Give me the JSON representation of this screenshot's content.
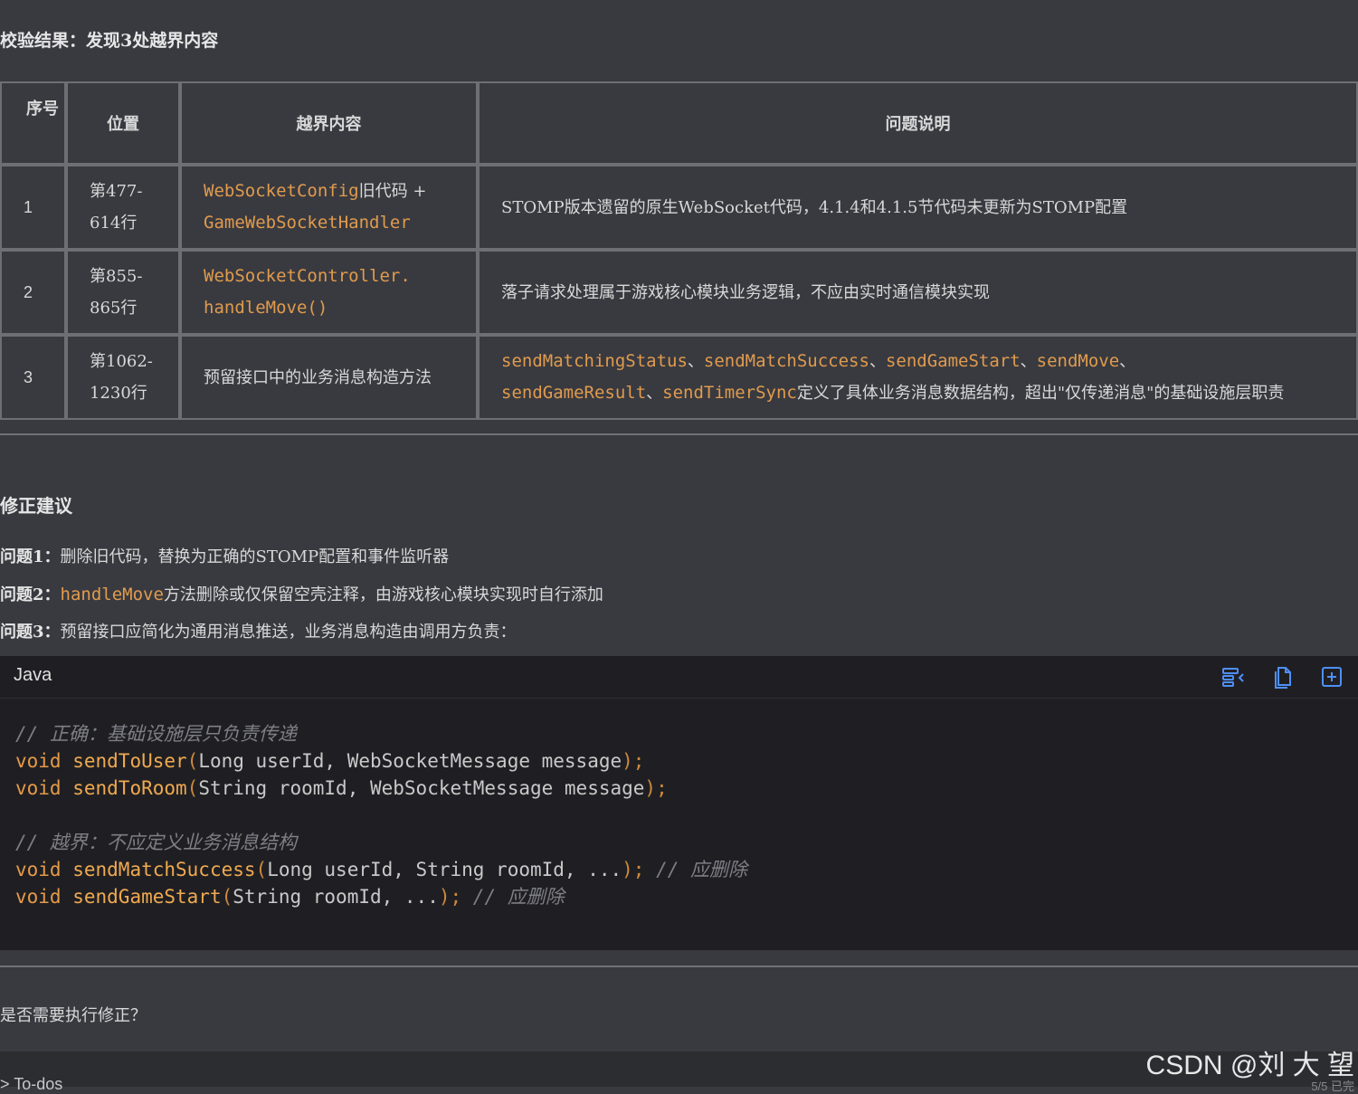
{
  "result_heading": "校验结果：发现3处越界内容",
  "table": {
    "headers": [
      "序号",
      "位置",
      "越界内容",
      "问题说明"
    ],
    "rows": [
      {
        "seq": "1",
        "location_a": "第477-",
        "location_b": "614行",
        "content_code_a": "WebSocketConfig",
        "content_text_a": "旧代码 +",
        "content_code_b": "GameWebSocketHandler",
        "description": "STOMP版本遗留的原生WebSocket代码，4.1.4和4.1.5节代码未更新为STOMP配置"
      },
      {
        "seq": "2",
        "location_a": "第855-",
        "location_b": "865行",
        "content_code_a": "WebSocketController.",
        "content_code_b": "handleMove()",
        "description": "落子请求处理属于游戏核心模块业务逻辑，不应由实时通信模块实现"
      },
      {
        "seq": "3",
        "location_a": "第1062-",
        "location_b": "1230行",
        "content_text": "预留接口中的业务消息构造方法",
        "desc_methods_1": [
          "sendMatchingStatus",
          "sendMatchSuccess",
          "sendGameStart",
          "sendMove"
        ],
        "desc_methods_2": [
          "sendGameResult",
          "sendTimerSync"
        ],
        "separator": "、",
        "description_tail": "定义了具体业务消息数据结构，超出\"仅传递消息\"的基础设施层职责"
      }
    ]
  },
  "fix": {
    "heading": "修正建议",
    "items": [
      {
        "label": "问题1：",
        "text": "删除旧代码，替换为正确的STOMP配置和事件监听器"
      },
      {
        "label": "问题2：",
        "code": "handleMove",
        "text": "方法删除或仅保留空壳注释，由游戏核心模块实现时自行添加"
      },
      {
        "label": "问题3：",
        "text": "预留接口应简化为通用消息推送，业务消息构造由调用方负责："
      }
    ]
  },
  "code_block": {
    "language": "Java",
    "tool_icons": [
      "wrap-icon",
      "copy-icon",
      "expand-icon"
    ],
    "comment_1": "// 正确：基础设施层只负责传递",
    "line_1": {
      "kw": "void",
      "fn": "sendToUser",
      "params": "Long userId, WebSocketMessage message"
    },
    "line_2": {
      "kw": "void",
      "fn": "sendToRoom",
      "params": "String roomId, WebSocketMessage message"
    },
    "comment_2": "// 越界：不应定义业务消息结构",
    "line_3": {
      "kw": "void",
      "fn": "sendMatchSuccess",
      "params": "Long userId, String roomId, ...",
      "trail": "// 应删除"
    },
    "line_4": {
      "kw": "void",
      "fn": "sendGameStart",
      "params": "String roomId, ...",
      "trail": "// 应删除"
    }
  },
  "confirm_text": "是否需要执行修正？",
  "todo_label": "> To-dos",
  "watermark": "CSDN @刘 大 望",
  "page_counter": "5/5 已完"
}
